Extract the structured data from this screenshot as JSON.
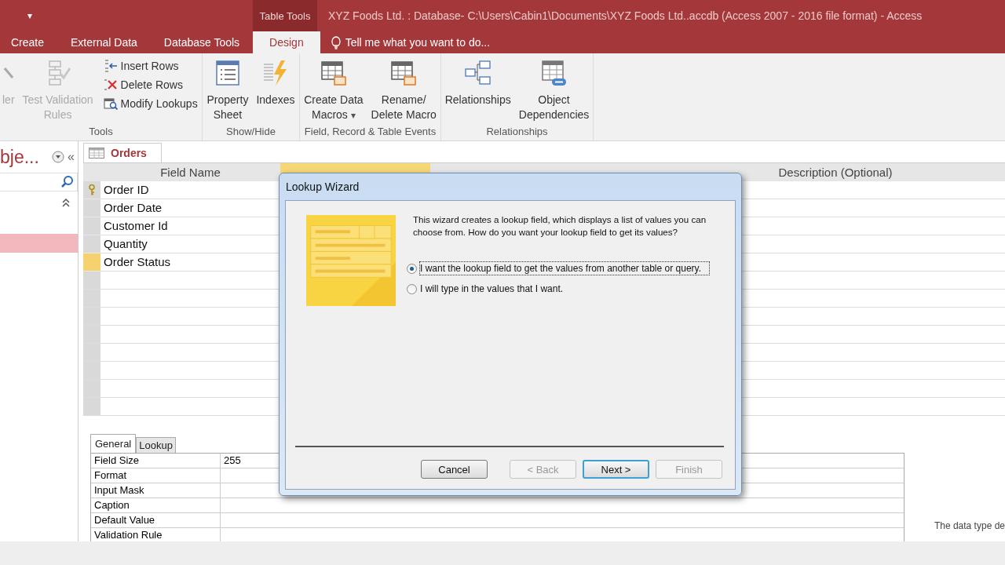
{
  "title_bar": {
    "quick_access": "▾",
    "context_tab": "Table Tools",
    "title": "XYZ Foods Ltd. : Database- C:\\Users\\Cabin1\\Documents\\XYZ Foods Ltd..accdb (Access 2007 - 2016 file format) - Access"
  },
  "ribbon_tabs": [
    {
      "label": "Create",
      "selected": false
    },
    {
      "label": "External Data",
      "selected": false
    },
    {
      "label": "Database Tools",
      "selected": false
    },
    {
      "label": "Design",
      "selected": true
    }
  ],
  "tell_me": {
    "placeholder": "Tell me what you want to do..."
  },
  "ribbon_groups": [
    {
      "label": "Tools",
      "large": [
        {
          "lines": [
            "ler"
          ],
          "disabled": true
        },
        {
          "lines": [
            "Test Validation",
            "Rules"
          ],
          "disabled": true
        }
      ],
      "small": [
        {
          "label": "Insert Rows"
        },
        {
          "label": "Delete Rows"
        },
        {
          "label": "Modify Lookups"
        }
      ]
    },
    {
      "label": "Show/Hide",
      "large": [
        {
          "lines": [
            "Property",
            "Sheet"
          ],
          "disabled": false
        },
        {
          "lines": [
            "Indexes"
          ],
          "disabled": false
        }
      ]
    },
    {
      "label": "Field, Record & Table Events",
      "large": [
        {
          "lines": [
            "Create Data",
            "Macros"
          ],
          "disabled": false,
          "dropdown": "▾"
        },
        {
          "lines": [
            "Rename/",
            "Delete Macro"
          ],
          "disabled": false
        }
      ]
    },
    {
      "label": "Relationships",
      "large": [
        {
          "lines": [
            "Relationships"
          ],
          "disabled": false
        },
        {
          "lines": [
            "Object",
            "Dependencies"
          ],
          "disabled": false
        }
      ]
    }
  ],
  "nav_pane": {
    "title": "bje...",
    "collapse": "«",
    "items": [
      {
        "selected": true
      }
    ]
  },
  "document_tab": {
    "label": "Orders"
  },
  "table": {
    "columns": [
      "Field Name",
      "Description (Optional)"
    ],
    "rows": [
      {
        "field_name": "Order ID",
        "primary_key": true,
        "selected": false
      },
      {
        "field_name": "Order Date",
        "primary_key": false,
        "selected": false
      },
      {
        "field_name": "Customer Id",
        "primary_key": false,
        "selected": false
      },
      {
        "field_name": "Quantity",
        "primary_key": false,
        "selected": false
      },
      {
        "field_name": "Order Status",
        "primary_key": false,
        "selected": true
      }
    ]
  },
  "properties": {
    "tabs": [
      {
        "label": "General",
        "selected": true
      },
      {
        "label": "Lookup",
        "selected": false
      }
    ],
    "rows": [
      {
        "label": "Field Size",
        "value": "255"
      },
      {
        "label": "Format"
      },
      {
        "label": "Input Mask"
      },
      {
        "label": "Caption"
      },
      {
        "label": "Default Value"
      },
      {
        "label": "Validation Rule"
      }
    ],
    "hint": "The data type de"
  },
  "dialog": {
    "title": "Lookup Wizard",
    "intro": "This wizard creates a lookup field, which displays a list of values you can choose from.  How do you want your lookup field to get its values?",
    "options": [
      {
        "label": "I want the lookup field to get the values from another table or query.",
        "selected": true
      },
      {
        "label": "I will type in the values that I want.",
        "selected": false
      }
    ],
    "buttons": [
      {
        "label": "Cancel",
        "disabled": false,
        "default": false
      },
      {
        "label": "< Back",
        "disabled": true,
        "default": false
      },
      {
        "label": "Next >",
        "disabled": false,
        "default": true
      },
      {
        "label": "Finish",
        "disabled": true,
        "default": false
      }
    ]
  }
}
